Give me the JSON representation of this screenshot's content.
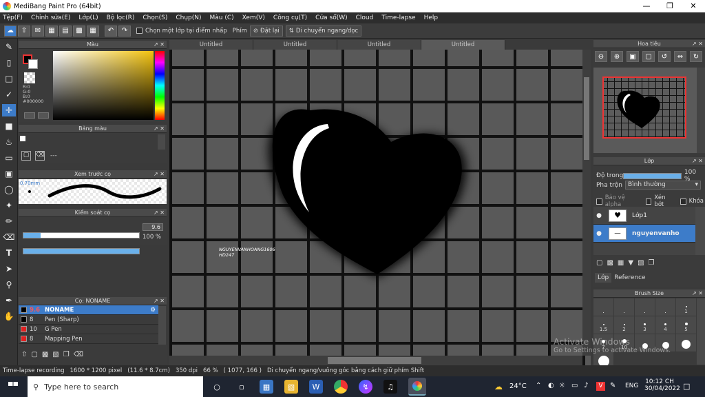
{
  "window": {
    "title": "MediBang Paint Pro (64bit)"
  },
  "menu": [
    "Tệp(F)",
    "Chỉnh sửa(E)",
    "Lớp(L)",
    "Bộ lọc(R)",
    "Chọn(S)",
    "Chụp(N)",
    "Màu (C)",
    "Xem(V)",
    "Công cụ(T)",
    "Cửa sổ(W)",
    "Cloud",
    "Time-lapse",
    "Help"
  ],
  "toolbar": {
    "checkbox_label": "Chọn một lớp tại điểm nhấp",
    "key_label": "Phím",
    "reset_label": "Đặt lại",
    "move_label": "Di chuyển ngang/dọc"
  },
  "tabs": [
    "Untitled",
    "Untitled",
    "Untitled",
    "Untitled"
  ],
  "color_panel": {
    "title": "Màu",
    "r": "R:0",
    "g": "G:0",
    "b": "B:0",
    "hex": "#000000"
  },
  "palette_panel": {
    "title": "Bảng màu",
    "dash": "---"
  },
  "brush_preview": {
    "title": "Xem trước cọ",
    "size": "0.70mm"
  },
  "brush_control": {
    "title": "Kiểm soát cọ",
    "size_value": "9.6",
    "size_fraction": 0.15,
    "opacity_value": "100 %",
    "opacity_fraction": 1.0
  },
  "brush_list": {
    "title": "Cọ: NONAME",
    "items": [
      {
        "size": "9.6",
        "name": "NONAME",
        "color": "#000000",
        "selected": true
      },
      {
        "size": "8",
        "name": "Pen (Sharp)",
        "color": "#000000",
        "selected": false
      },
      {
        "size": "10",
        "name": "G Pen",
        "color": "#e02020",
        "selected": false
      },
      {
        "size": "8",
        "name": "Mapping Pen",
        "color": "#e02020",
        "selected": false
      }
    ]
  },
  "canvas": {
    "watermark_line1": "NGUYENVANHOANG1606",
    "watermark_line2": "HD247"
  },
  "navigator": {
    "title": "Hoa tiêu"
  },
  "layer_panel": {
    "title": "Lớp",
    "opacity_label": "Độ trong",
    "opacity_value": "100 %",
    "opacity_fraction": 1.0,
    "blend_label": "Pha trộn",
    "blend_value": "Bình thường",
    "protect_alpha": "Bảo vệ alpha",
    "clipping": "Xén bớt",
    "lock": "Khóa",
    "layers": [
      {
        "name": "Lớp1",
        "selected": false
      },
      {
        "name": "nguyenvanho",
        "selected": true
      }
    ],
    "tab_layer": "Lớp",
    "tab_reference": "Reference"
  },
  "brush_size": {
    "title": "Brush Size",
    "sizes": [
      "",
      "",
      "",
      "",
      "1",
      "1.5",
      "2",
      "3",
      "4",
      "5",
      "7",
      "10",
      "",
      "",
      "",
      ""
    ]
  },
  "activate": {
    "line1": "Activate Windows",
    "line2": "Go to Settings to activate Windows."
  },
  "status": {
    "recording": "Time-lapse recording",
    "size_px": "1600 * 1200 pixel",
    "size_cm": "(11.6 * 8.7cm)",
    "dpi": "350 dpi",
    "zoom": "66 %",
    "coords": "( 1077, 166 )",
    "hint": "Di chuyển ngang/vuông góc bằng cách giữ phím Shift"
  },
  "taskbar": {
    "search_placeholder": "Type here to search",
    "temp": "24°C",
    "lang": "ENG",
    "time": "10:12 CH",
    "date": "30/04/2022"
  },
  "colors": {
    "accent": "#3d7cc9",
    "panel": "#3b3b3b",
    "canvas_bg": "#5a5a5a"
  }
}
